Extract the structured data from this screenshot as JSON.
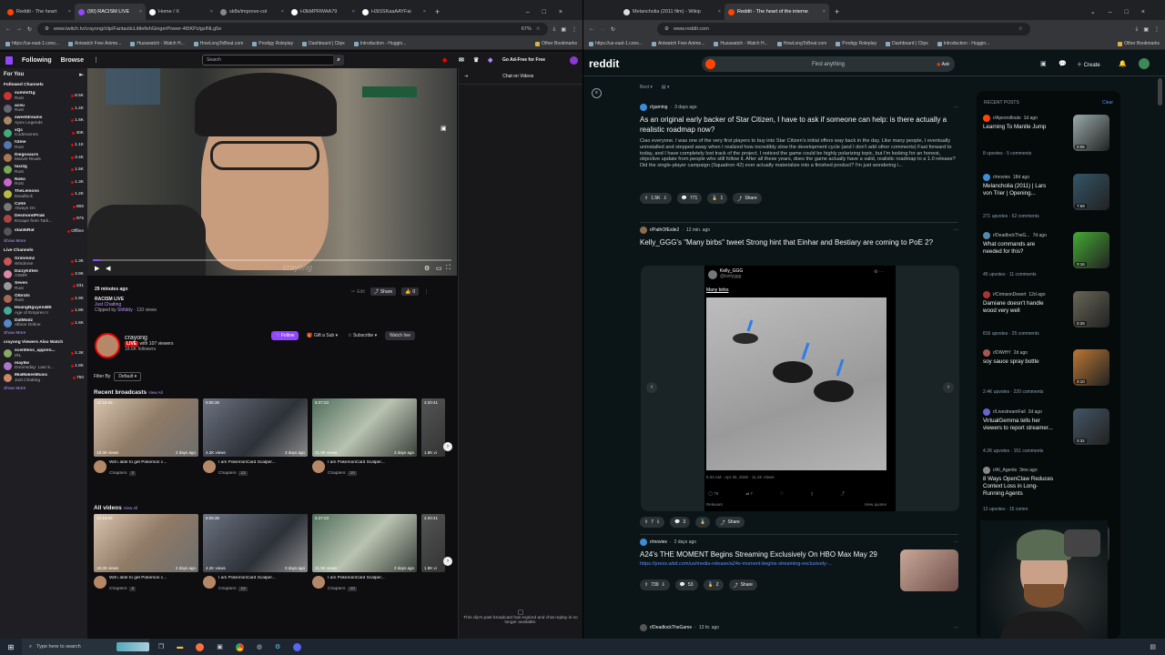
{
  "left_window": {
    "tabs": [
      {
        "label": "Reddit - The heart",
        "color": "#ff4500"
      },
      {
        "label": "(90) RACISM LIVE",
        "color": "#9146ff",
        "active": true
      },
      {
        "label": "Home / X",
        "color": "#fff"
      },
      {
        "label": "sk8s/improve-col",
        "color": "#888"
      },
      {
        "label": "H3kMPRWAA79",
        "color": "#fff"
      },
      {
        "label": "H3iSSKaaAAYFai",
        "color": "#fff"
      }
    ],
    "url": "www.twitch.tv/crayong/clip/FantasticLittlefishGingerPower-4t5KPzlgzINLg5e",
    "zoom": "67%",
    "bookmarks": [
      "https://us-east-1.cons...",
      "Aniwatch Free Anime...",
      "Huzawatch - Watch H...",
      "HowLongToBeat.com",
      "Prodigy Roleplay",
      "Dashboard | Clipx",
      "Introduction - Huggin...",
      "Other Bookmarks"
    ]
  },
  "twitch": {
    "nav": {
      "following": "Following",
      "browse": "Browse",
      "search_placeholder": "Search",
      "ad_free": "Go Ad-Free for Free"
    },
    "for_you": "For You",
    "followed_title": "Followed Channels",
    "followed": [
      {
        "name": "summit1g",
        "game": "Rust",
        "viewers": "8.5K",
        "color": "#c33"
      },
      {
        "name": "aceu",
        "game": "Rust",
        "viewers": "1.4K",
        "color": "#667"
      },
      {
        "name": "sweetdreams",
        "game": "Apex Legends",
        "viewers": "1.6K",
        "color": "#a86"
      },
      {
        "name": "xQc",
        "game": "Codenames",
        "viewers": "40K",
        "color": "#4a7"
      },
      {
        "name": "h3me",
        "game": "Rust",
        "viewers": "1.1K",
        "color": "#57a"
      },
      {
        "name": "Diegosaurs",
        "game": "Marvel Rivals",
        "viewers": "3.4K",
        "color": "#a75"
      },
      {
        "name": "taxi2g",
        "game": "Rust",
        "viewers": "1.5K",
        "color": "#7a5"
      },
      {
        "name": "Noko",
        "game": "Rust",
        "viewers": "1.3K",
        "color": "#c6c"
      },
      {
        "name": "TheLemons",
        "game": "Deadlock",
        "viewers": "1.2K",
        "color": "#bb4"
      },
      {
        "name": "Cohh",
        "game": "Always On",
        "viewers": "906",
        "color": "#777"
      },
      {
        "name": "DesmondPilak",
        "game": "Escape from Tark...",
        "viewers": "975",
        "color": "#a44"
      },
      {
        "name": "stanIkRat",
        "game": "",
        "viewers": "Offline",
        "color": "#555"
      }
    ],
    "show_more": "Show More",
    "live_title": "Live Channels",
    "live": [
      {
        "name": "Grimmmz",
        "game": "Windrose",
        "viewers": "1.3K",
        "color": "#c55"
      },
      {
        "name": "DizzyKitten",
        "game": "ASMR",
        "viewers": "3.9K",
        "color": "#d8a"
      },
      {
        "name": "Seven",
        "game": "Rust",
        "viewers": "231",
        "color": "#999"
      },
      {
        "name": "Olbrats",
        "game": "Rust",
        "viewers": "1.9K",
        "color": "#a65"
      },
      {
        "name": "HoangNguyen485",
        "game": "Age of Empires II",
        "viewers": "1.8K",
        "color": "#4a9"
      },
      {
        "name": "DatModz",
        "game": "Albion Online",
        "viewers": "1.6K",
        "color": "#58c"
      }
    ],
    "also_title": "crayong Viewers Also Watch",
    "also": [
      {
        "name": "scentless_appren...",
        "game": "IRL",
        "viewers": "1.3K",
        "color": "#8a6"
      },
      {
        "name": "may5w",
        "game": "Doomsday: Last S...",
        "viewers": "1.8K",
        "color": "#a7c"
      },
      {
        "name": "MiaMakesMusic",
        "game": "Just Chatting",
        "viewers": "750",
        "color": "#c86"
      }
    ],
    "video_overlay": "crayong",
    "clip_time": "29 minutes ago",
    "clip_title": "RACISM LIVE",
    "clip_category": "Just Chatting",
    "clipped_by": "Clipped by",
    "clipper": "Shfiddy",
    "clip_views": "110 views",
    "edit": "Edit",
    "share": "Share",
    "like_count": "0",
    "channel": {
      "name": "crayong",
      "live": "LIVE",
      "viewers": "with 107 viewers",
      "followers": "18.6K followers"
    },
    "actions": {
      "follow": "Follow",
      "gift": "Gift a Sub",
      "subscribe": "Subscribe",
      "watch": "Watch live"
    },
    "filter_by": "Filter By",
    "filter_value": "Default",
    "recent_title": "Recent broadcasts",
    "all_title": "All videos",
    "view_all": "View All",
    "cards": [
      {
        "dur": "12:16:50",
        "views": "19.3K views",
        "ago": "2 days ago",
        "title": "Will i able to get Pokemon c...",
        "chapters": "Chapters",
        "ch_count": "2"
      },
      {
        "dur": "6:06:35",
        "views": "4.2K views",
        "ago": "3 days ago",
        "title": "I am PokemonCard Scalper...",
        "chapters": "Chapters",
        "ch_count": "12"
      },
      {
        "dur": "5:37:23",
        "views": "21.9K views",
        "ago": "3 days ago",
        "title": "I am PokemonCard Scalper...",
        "chapters": "Chapters",
        "ch_count": "10"
      },
      {
        "dur": "4:20:41",
        "views": "1.8K vi",
        "ago": "",
        "title": "",
        "chapters": "",
        "ch_count": ""
      }
    ],
    "chat_title": "Chat on Videos",
    "chat_expired": "This clip's past broadcast has expired and chat replay is no longer available."
  },
  "right_window": {
    "tabs": [
      {
        "label": "Melancholia (2011 film) - Wikip",
        "color": "#ddd"
      },
      {
        "label": "Reddit - The heart of the interne",
        "color": "#ff4500",
        "active": true
      }
    ],
    "url": "www.reddit.com",
    "bookmarks": [
      "https://us-east-1.cons...",
      "Aniwatch Free Anime...",
      "Huzawatch - Watch H...",
      "HowLongToBeat.com",
      "Prodigy Roleplay",
      "Dashboard | Clipx",
      "Introduction - Huggin...",
      "Other Bookmarks"
    ]
  },
  "reddit": {
    "logo": "reddit",
    "search_placeholder": "Find anything",
    "ask": "Ask",
    "create": "Create",
    "sort": "Best",
    "posts": [
      {
        "sub": "r/gaming",
        "ago": "3 days ago",
        "title": "As an original early backer of Star Citizen, I have to ask if someone can help: is there actually a realistic roadmap now?",
        "body": "Ciao everyone. I was one of the very first players to buy into Star Citizen's initial offers way back in the day. Like many people, I eventually uninstalled and stepped away when I realized how incredibly slow the development cycle (and I don't add other comments) Fast forward to today, and I have completely lost track of the project. I noticed the game could be highly polarizing topic, but I'm looking for an honest, objective update from people who still follow it. After all these years, does the game actually have a valid, realistic roadmap to a 1.0 release? Did the single-player campaign (Squadron 42) ever actually materialize into a finished product? I'm just wondering i...",
        "votes": "1.5K",
        "comments": "771",
        "awards": "1",
        "share": "Share"
      },
      {
        "sub": "r/PathOfExile2",
        "ago": "12 min. ago",
        "title": "Kelly_GGG's \"Many birbs\" tweet Strong hint that Einhar and Bestiary are coming to PoE 2?",
        "tweet_user": "Kelly_GGG",
        "tweet_handle": "@kellyggg",
        "tweet_text": "Many birbs",
        "tweet_time": "6:34 AM · Apr 25, 2026 · 11.2K Views",
        "tweet_stats": [
          "75",
          "7",
          "",
          ""
        ],
        "relevant": "Relevant",
        "view_quotes": "View quotes",
        "votes": "7",
        "comments": "3",
        "share": "Share"
      },
      {
        "sub": "r/movies",
        "ago": "2 days ago",
        "title": "A24's THE MOMENT Begins Streaming Exclusively On HBO Max May 29",
        "link": "https://press.wbd.com/us/media-release/a24s-moment-begins-streaming-exclusively-...",
        "votes": "739",
        "comments": "53",
        "awards": "2",
        "share": "Share"
      },
      {
        "sub": "r/DeadlockTheGame",
        "ago": "13 hr. ago"
      }
    ],
    "recent_title": "RECENT POSTS",
    "clear": "Clear",
    "recent": [
      {
        "sub": "r/Apexrollouts",
        "ago": "1d ago",
        "title": "Learning To Mantle Jump",
        "stats": "8 upvotes · 5 comments",
        "dur": "0:05",
        "color": "#9aa"
      },
      {
        "sub": "r/movies",
        "ago": "18d ago",
        "title": "Melancholia (2011) | Lars von Trier | Opening...",
        "stats": "271 upvotes · 62 comments",
        "dur": "7:59",
        "color": "#356"
      },
      {
        "sub": "r/DeadlockTheG...",
        "ago": "7d ago",
        "title": "What commands are needed for this?",
        "stats": "45 upvotes · 11 comments",
        "dur": "0:16",
        "color": "#4a3"
      },
      {
        "sub": "r/CrimsonDesert",
        "ago": "12d ago",
        "title": "Damiane doesn't handle wood very well",
        "stats": "816 upvotes · 25 comments",
        "dur": "0:26",
        "color": "#665"
      },
      {
        "sub": "r/DIWHY",
        "ago": "2d ago",
        "title": "soy sauce spray bottle",
        "stats": "2.4K upvotes · 220 comments",
        "dur": "0:10",
        "color": "#b73"
      },
      {
        "sub": "r/LivestreamFail",
        "ago": "2d ago",
        "title": "VirtualGemma tells her viewers to report streamer...",
        "stats": "4.2K upvotes · 151 comments",
        "dur": "0:32",
        "color": "#456"
      },
      {
        "sub": "r/AI_Agents",
        "ago": "3mo ago",
        "title": "8 Ways OpenClaw Reduces Context Loss in Long-Running Agents",
        "stats": "12 upvotes · 15 comm",
        "dur": "",
        "color": ""
      },
      {
        "sub": "r/Livestr",
        "ago": "",
        "title": "Can anybo...",
        "stats": "",
        "dur": "",
        "color": "#556"
      },
      {
        "sub": "r/scifi",
        "ago": "",
        "title": "Aven abc",
        "stats": "",
        "dur": "",
        "color": ""
      }
    ]
  },
  "taskbar": {
    "search_placeholder": "Type here to search"
  }
}
